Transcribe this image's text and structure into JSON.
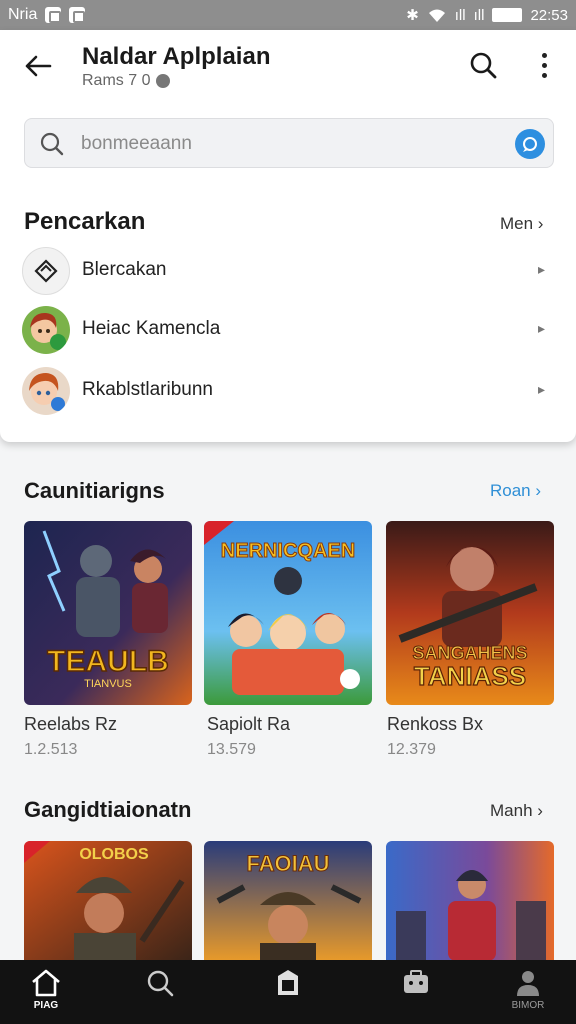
{
  "status": {
    "carrier": "Nria",
    "time": "22:53",
    "signal1": "ıll",
    "signal2": "ıll"
  },
  "appbar": {
    "title": "Naldar Aplplaian",
    "subtitle": "Rams 7 0"
  },
  "search": {
    "placeholder": "bonmeeaann"
  },
  "section1": {
    "title": "Pencarkan",
    "link": "Men",
    "items": [
      {
        "label": "Blercakan",
        "icon": "diamond-icon"
      },
      {
        "label": "Heiac Kamencla",
        "icon": "avatar"
      },
      {
        "label": "Rkablstlaribunn",
        "icon": "avatar"
      }
    ]
  },
  "section2": {
    "title": "Caunitiarigns",
    "link": "Roan",
    "games": [
      {
        "name": "Reelabs Rz",
        "count": "1.2.513",
        "art_title": "TEAULB",
        "art_sub": "TIANVUS"
      },
      {
        "name": "Sapiolt Ra",
        "count": "13.579",
        "art_title": "NERNICQAEN"
      },
      {
        "name": "Renkoss Bx",
        "count": "12.379",
        "art_title": "SANGAHENS",
        "art_sub": "TANIASS"
      }
    ]
  },
  "section3": {
    "title": "Gangidtiaionatn",
    "link": "Manh",
    "games": [
      {
        "art_title": "OLOBOS"
      },
      {
        "art_title": "FAOIAU"
      },
      {
        "art_title": ""
      }
    ]
  },
  "bottomnav": {
    "items": [
      {
        "label": "PIAG"
      },
      {
        "label": ""
      },
      {
        "label": ""
      },
      {
        "label": ""
      },
      {
        "label": "BIMOR"
      }
    ]
  },
  "colors": {
    "accent": "#2f8fd6",
    "statusbar": "#8e8e8e",
    "nav": "#121212"
  }
}
